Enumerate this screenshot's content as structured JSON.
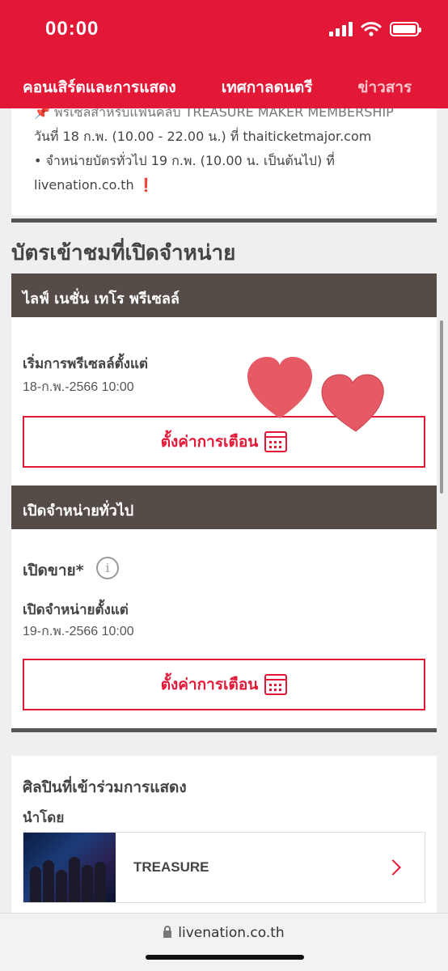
{
  "status_bar": {
    "time": "00:00"
  },
  "nav": {
    "items": [
      "คอนเสิร์ตและการแสดง",
      "เทศกาลดนตรี",
      "ข่าวสาร"
    ]
  },
  "top_card": {
    "line_cut": "📌 พรีเซลสำหรับแฟนคลับ TREASURE MAKER MEMBERSHIP",
    "line1": "วันที่ 18 ก.พ. (10.00 - 22.00 น.) ที่ thaiticketmajor.com",
    "line2": "• จำหน่ายบัตรทั่วไป 19 ก.พ. (10.00 น. เป็นต้นไป) ที่",
    "line3": "livenation.co.th",
    "line3_mark": "❗"
  },
  "section": {
    "title": "บัตรเข้าชมที่เปิดจำหน่าย"
  },
  "presale": {
    "header": "ไลฟ์ เนชั่น เทโร พรีเซลล์",
    "start_label": "เริ่มการพรีเซลล์ตั้งแต่",
    "start_value": "18-ก.พ.-2566 10:00",
    "reminder_button": "ตั้งค่าการเตือน"
  },
  "general_sale": {
    "header": "เปิดจำหน่ายทั่วไป",
    "sale_title": "เปิดขาย*",
    "info_icon": "i",
    "start_label": "เปิดจำหน่ายตั้งแต่",
    "start_value": "19-ก.พ.-2566 10:00",
    "reminder_button": "ตั้งค่าการเตือน"
  },
  "artists": {
    "title": "ศิลปินที่เข้าร่วมการแสดง",
    "led_by": "นำโดย",
    "items": [
      {
        "name": "TREASURE"
      }
    ]
  },
  "browser": {
    "url": "livenation.co.th"
  },
  "colors": {
    "brand": "#e31837",
    "header_dark": "#554b47",
    "heart": "#e65a66"
  }
}
